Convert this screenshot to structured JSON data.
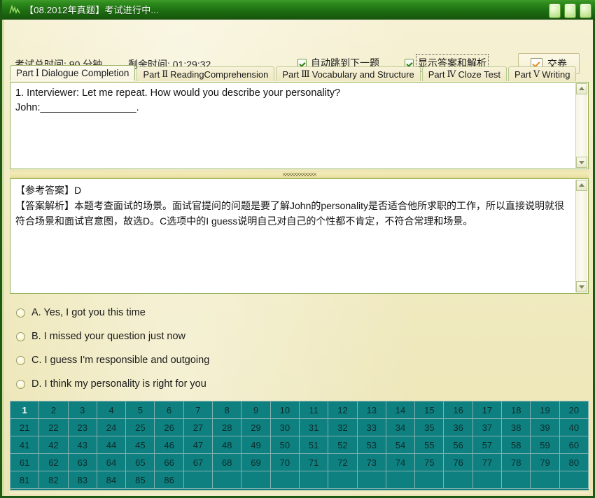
{
  "window": {
    "title": "【08.2012年真题】考试进行中...",
    "icon": "app-icon",
    "buttons": [
      "minimize-button",
      "maximize-button",
      "close-button"
    ],
    "accent_green": "#1d6c11",
    "background": "#f2ecc6"
  },
  "toolbar": {
    "total_time_label": "考试总时间: 90 分钟",
    "remaining_label": "剩余时间: 01:29:32",
    "auto_next": {
      "label": "自动跳到下一题",
      "checked": true
    },
    "show_answer": {
      "label": "显示答案和解析",
      "checked": true,
      "focused": true
    },
    "submit": {
      "label": "交卷",
      "check_color": "#e88a18"
    }
  },
  "tabs": [
    {
      "prefix": "Part",
      "roman": "Ⅰ",
      "label": "Dialogue Completion",
      "active": true
    },
    {
      "prefix": "Part",
      "roman": "Ⅱ",
      "label": "ReadingComprehension",
      "active": false
    },
    {
      "prefix": "Part",
      "roman": "Ⅲ",
      "label": "Vocabulary and Structure",
      "active": false
    },
    {
      "prefix": "Part",
      "roman": "Ⅳ",
      "label": "Cloze Test",
      "active": false
    },
    {
      "prefix": "Part",
      "roman": "Ⅴ",
      "label": "Writing",
      "active": false
    }
  ],
  "question": {
    "text": "1. Interviewer: Let me repeat. How would you describe your personality?\nJohn:_________________."
  },
  "answer": {
    "text": "【参考答案】D\n【答案解析】本题考查面试的场景。面试官提问的问题是要了解John的personality是否适合他所求职的工作，所以直接说明就很符合场景和面试官意图，故选D。C选项中的I guess说明自己对自己的个性都不肯定，不符合常理和场景。"
  },
  "options": [
    {
      "letter": "A.",
      "text": "A. Yes, I got you this time",
      "selected": false
    },
    {
      "letter": "B.",
      "text": "B. I missed your question just now",
      "selected": false
    },
    {
      "letter": "C.",
      "text": "C. I guess I'm responsible and outgoing",
      "selected": false
    },
    {
      "letter": "D.",
      "text": "D. I think my personality is right for you",
      "selected": false
    }
  ],
  "number_grid": {
    "columns": 20,
    "total": 86,
    "current": 1,
    "cell_color": "#0f8080",
    "numbers": [
      1,
      2,
      3,
      4,
      5,
      6,
      7,
      8,
      9,
      10,
      11,
      12,
      13,
      14,
      15,
      16,
      17,
      18,
      19,
      20,
      21,
      22,
      23,
      24,
      25,
      26,
      27,
      28,
      29,
      30,
      31,
      32,
      33,
      34,
      35,
      36,
      37,
      38,
      39,
      40,
      41,
      42,
      43,
      44,
      45,
      46,
      47,
      48,
      49,
      50,
      51,
      52,
      53,
      54,
      55,
      56,
      57,
      58,
      59,
      60,
      61,
      62,
      63,
      64,
      65,
      66,
      67,
      68,
      69,
      70,
      71,
      72,
      73,
      74,
      75,
      76,
      77,
      78,
      79,
      80,
      81,
      82,
      83,
      84,
      85,
      86
    ]
  }
}
